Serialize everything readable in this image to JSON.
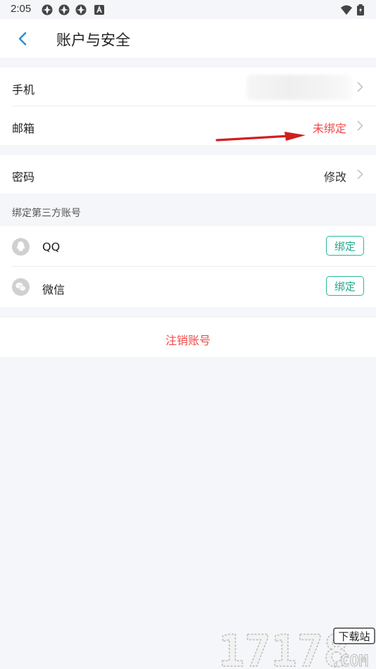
{
  "status_bar": {
    "time": "2:05"
  },
  "header": {
    "title": "账户与安全"
  },
  "account": {
    "phone_label": "手机",
    "email_label": "邮箱",
    "email_value": "未绑定"
  },
  "password": {
    "label": "密码",
    "value": "修改"
  },
  "third_party": {
    "title": "绑定第三方账号",
    "items": [
      {
        "name": "QQ",
        "button": "绑定",
        "icon": "qq-icon"
      },
      {
        "name": "微信",
        "button": "绑定",
        "icon": "wechat-icon"
      }
    ]
  },
  "delete_account": "注销账号",
  "watermark": {
    "text": "17178",
    "badge": "下载站",
    "suffix": ".COM"
  },
  "colors": {
    "red": "#ef4a4a",
    "green": "#1faa8e",
    "blue": "#2b8fd6",
    "background": "#f4f6f9"
  }
}
